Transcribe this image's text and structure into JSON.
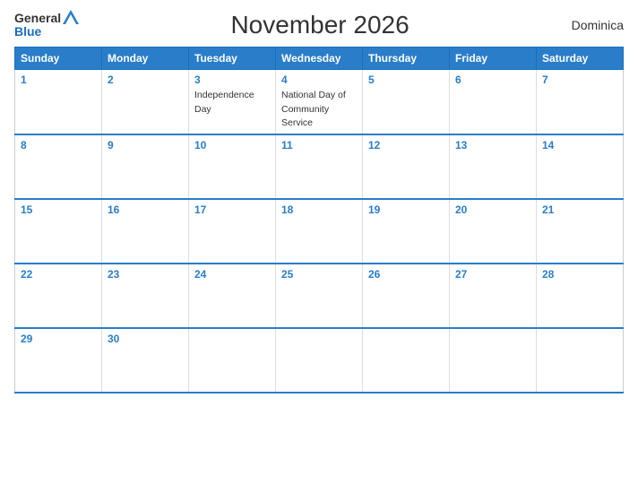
{
  "header": {
    "logo_general": "General",
    "logo_blue": "Blue",
    "title": "November 2026",
    "country": "Dominica"
  },
  "weekdays": [
    "Sunday",
    "Monday",
    "Tuesday",
    "Wednesday",
    "Thursday",
    "Friday",
    "Saturday"
  ],
  "weeks": [
    [
      {
        "day": "1",
        "event": ""
      },
      {
        "day": "2",
        "event": ""
      },
      {
        "day": "3",
        "event": "Independence Day"
      },
      {
        "day": "4",
        "event": "National Day of Community Service"
      },
      {
        "day": "5",
        "event": ""
      },
      {
        "day": "6",
        "event": ""
      },
      {
        "day": "7",
        "event": ""
      }
    ],
    [
      {
        "day": "8",
        "event": ""
      },
      {
        "day": "9",
        "event": ""
      },
      {
        "day": "10",
        "event": ""
      },
      {
        "day": "11",
        "event": ""
      },
      {
        "day": "12",
        "event": ""
      },
      {
        "day": "13",
        "event": ""
      },
      {
        "day": "14",
        "event": ""
      }
    ],
    [
      {
        "day": "15",
        "event": ""
      },
      {
        "day": "16",
        "event": ""
      },
      {
        "day": "17",
        "event": ""
      },
      {
        "day": "18",
        "event": ""
      },
      {
        "day": "19",
        "event": ""
      },
      {
        "day": "20",
        "event": ""
      },
      {
        "day": "21",
        "event": ""
      }
    ],
    [
      {
        "day": "22",
        "event": ""
      },
      {
        "day": "23",
        "event": ""
      },
      {
        "day": "24",
        "event": ""
      },
      {
        "day": "25",
        "event": ""
      },
      {
        "day": "26",
        "event": ""
      },
      {
        "day": "27",
        "event": ""
      },
      {
        "day": "28",
        "event": ""
      }
    ],
    [
      {
        "day": "29",
        "event": ""
      },
      {
        "day": "30",
        "event": ""
      },
      {
        "day": "",
        "event": ""
      },
      {
        "day": "",
        "event": ""
      },
      {
        "day": "",
        "event": ""
      },
      {
        "day": "",
        "event": ""
      },
      {
        "day": "",
        "event": ""
      }
    ]
  ]
}
